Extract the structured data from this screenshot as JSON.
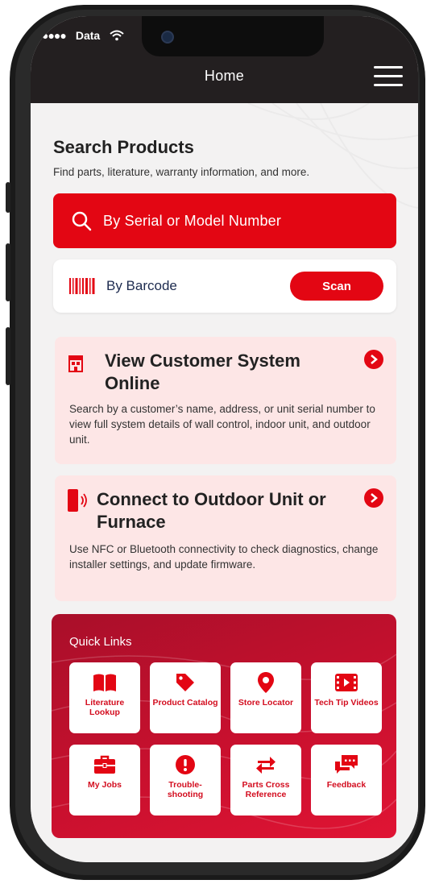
{
  "status": {
    "carrier": "Data"
  },
  "header": {
    "title": "Home"
  },
  "search": {
    "heading": "Search Products",
    "subtitle": "Find parts, literature, warranty information, and more.",
    "serial_label": "By Serial or Model Number",
    "barcode_label": "By Barcode",
    "scan_label": "Scan"
  },
  "cards": [
    {
      "title": "View Customer System Online",
      "description": "Search by a customer’s name, address, or unit serial number to view full system details of wall control, indoor unit, and outdoor unit."
    },
    {
      "title": "Connect to Outdoor Unit or Furnace",
      "description": "Use NFC or Bluetooth connectivity to check diagnostics, change installer settings, and update firmware."
    }
  ],
  "quick_links": {
    "title": "Quick Links",
    "items": [
      {
        "label": "Literature Lookup",
        "icon": "book-icon"
      },
      {
        "label": "Product Catalog",
        "icon": "tag-icon"
      },
      {
        "label": "Store Locator",
        "icon": "map-pin-icon"
      },
      {
        "label": "Tech Tip Videos",
        "icon": "film-icon"
      },
      {
        "label": "My Jobs",
        "icon": "briefcase-icon"
      },
      {
        "label": "Trouble-shooting",
        "icon": "alert-icon"
      },
      {
        "label": "Parts Cross Reference",
        "icon": "swap-arrows-icon"
      },
      {
        "label": "Feedback",
        "icon": "chat-icon"
      }
    ]
  },
  "colors": {
    "accent": "#e30613",
    "header_bg": "#231f20",
    "card_bg": "#fde6e6"
  }
}
